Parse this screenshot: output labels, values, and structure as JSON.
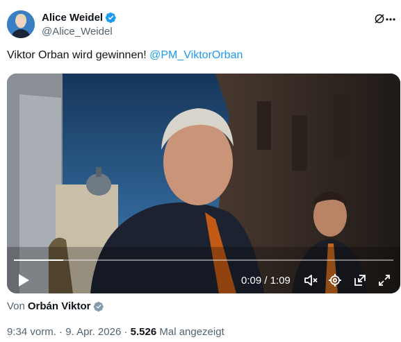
{
  "author": {
    "display_name": "Alice Weidel",
    "handle": "@Alice_Weidel"
  },
  "tweet": {
    "text": "Viktor Orban wird gewinnen! ",
    "mention": "@PM_ViktorOrban"
  },
  "video": {
    "time_display": "0:09 / 1:09",
    "progress": 0.13
  },
  "attribution": {
    "prefix": "Von",
    "author": "Orbán Viktor"
  },
  "meta": {
    "time": "9:34 vorm.",
    "separator1": " · ",
    "date": "9. Apr. 2026",
    "separator2": " · ",
    "views_count": "5.526",
    "views_label": " Mal angezeigt"
  },
  "colors": {
    "accent": "#1d9bf0",
    "secondary_text": "#536471"
  },
  "icons": [
    "verified-badge-icon",
    "grok-icon",
    "more-icon",
    "play-icon",
    "mute-icon",
    "settings-icon",
    "minimize-icon",
    "fullscreen-icon",
    "grey-verified-badge-icon"
  ]
}
